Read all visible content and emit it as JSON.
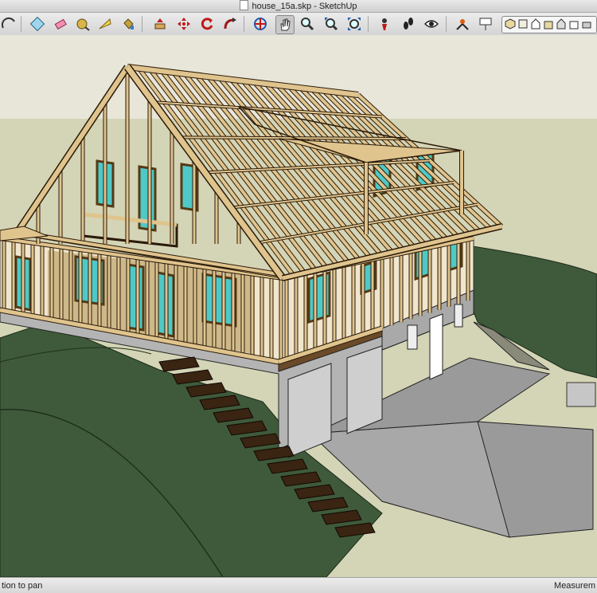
{
  "window": {
    "title": "house_15a.skp - SketchUp"
  },
  "toolbar": {
    "tools": [
      {
        "name": "arc-tool"
      },
      {
        "name": "paint-bucket-tool"
      },
      {
        "name": "eraser-tool"
      },
      {
        "name": "tape-measure-tool"
      },
      {
        "name": "protractor-tool"
      },
      {
        "name": "paint-tool"
      },
      {
        "name": "push-pull-tool"
      },
      {
        "name": "move-tool"
      },
      {
        "name": "rotate-tool"
      },
      {
        "name": "follow-me-tool"
      },
      {
        "name": "orbit-tool"
      },
      {
        "name": "pan-tool"
      },
      {
        "name": "zoom-tool"
      },
      {
        "name": "zoom-extents-tool"
      },
      {
        "name": "position-camera-tool"
      },
      {
        "name": "walk-tool"
      },
      {
        "name": "look-around-tool"
      },
      {
        "name": "section-plane-tool"
      },
      {
        "name": "text-tool"
      }
    ],
    "views": [
      "iso-view",
      "top-view",
      "front-view",
      "right-view",
      "back-view",
      "left-view",
      "bottom-view"
    ]
  },
  "status": {
    "hint": "tion to pan",
    "measurements_label": "Measurem"
  },
  "colors": {
    "sky": "#e8e6d8",
    "ground": "#d4d4b6",
    "grass": "#3f5a3a",
    "lumber": "#e0c48e",
    "glass": "#4ec9c7",
    "concrete": "#a8a8a8"
  }
}
